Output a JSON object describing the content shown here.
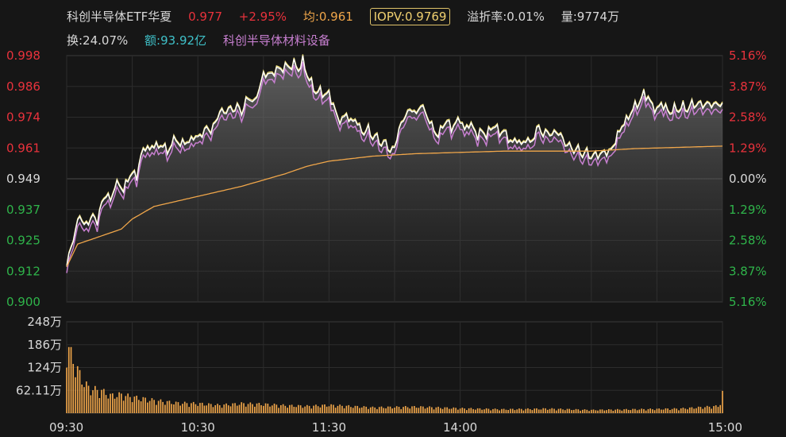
{
  "header": {
    "name": "科创半导体ETF华夏",
    "price": "0.977",
    "change_pct": "+2.95%",
    "avg": "均:0.961",
    "iopv": "IOPV:0.9769",
    "premium": "溢折率:0.01%",
    "volume": "量:9774万",
    "turnover": "换:24.07%",
    "amount": "额:93.92亿",
    "index_name": "科创半导体材料设备"
  },
  "colors": {
    "background": "#161616",
    "up": "#e8323c",
    "down": "#2fb44a",
    "neutral": "#d8d8d8",
    "price_line": "#ffffff",
    "iopv_line": "#f2e27a",
    "index_line": "#c77fd0",
    "avg_line": "#f0a64a",
    "volume_bar": "#f0a64a",
    "amount_text": "#3fc0c8"
  },
  "chart_data": {
    "type": "line",
    "x_ticks": [
      "09:30",
      "10:30",
      "11:30",
      "14:00",
      "15:00"
    ],
    "ylim": [
      0.9,
      0.998
    ],
    "y_ticks_left": [
      "0.998",
      "0.986",
      "0.974",
      "0.961",
      "0.949",
      "0.937",
      "0.925",
      "0.912",
      "0.900"
    ],
    "y_ticks_right": [
      "5.16%",
      "3.87%",
      "2.58%",
      "1.29%",
      "0.00%",
      "1.29%",
      "2.58%",
      "3.87%",
      "5.16%"
    ],
    "volume_ticks": [
      "248万",
      "186万",
      "124万",
      "62.11万"
    ],
    "volume_ylim": [
      0,
      248
    ],
    "price_anchors": [
      [
        0,
        0.914
      ],
      [
        2,
        0.922
      ],
      [
        4,
        0.928
      ],
      [
        6,
        0.935
      ],
      [
        8,
        0.93
      ],
      [
        10,
        0.932
      ],
      [
        12,
        0.934
      ],
      [
        14,
        0.932
      ],
      [
        16,
        0.939
      ],
      [
        18,
        0.943
      ],
      [
        20,
        0.94
      ],
      [
        22,
        0.946
      ],
      [
        24,
        0.947
      ],
      [
        26,
        0.944
      ],
      [
        28,
        0.949
      ],
      [
        30,
        0.951
      ],
      [
        32,
        0.95
      ],
      [
        34,
        0.958
      ],
      [
        36,
        0.962
      ],
      [
        38,
        0.96
      ],
      [
        40,
        0.963
      ],
      [
        42,
        0.961
      ],
      [
        44,
        0.963
      ],
      [
        46,
        0.959
      ],
      [
        48,
        0.963
      ],
      [
        50,
        0.965
      ],
      [
        52,
        0.962
      ],
      [
        54,
        0.964
      ],
      [
        56,
        0.963
      ],
      [
        58,
        0.966
      ],
      [
        60,
        0.965
      ],
      [
        62,
        0.967
      ],
      [
        64,
        0.969
      ],
      [
        66,
        0.968
      ],
      [
        68,
        0.971
      ],
      [
        70,
        0.976
      ],
      [
        72,
        0.975
      ],
      [
        74,
        0.977
      ],
      [
        76,
        0.976
      ],
      [
        78,
        0.978
      ],
      [
        80,
        0.975
      ],
      [
        82,
        0.98
      ],
      [
        84,
        0.981
      ],
      [
        86,
        0.979
      ],
      [
        88,
        0.985
      ],
      [
        90,
        0.99
      ],
      [
        92,
        0.991
      ],
      [
        94,
        0.99
      ],
      [
        96,
        0.993
      ],
      [
        98,
        0.992
      ],
      [
        100,
        0.994
      ],
      [
        102,
        0.993
      ],
      [
        104,
        0.995
      ],
      [
        106,
        0.992
      ],
      [
        108,
        0.996
      ],
      [
        110,
        0.99
      ],
      [
        112,
        0.987
      ],
      [
        114,
        0.983
      ],
      [
        116,
        0.984
      ],
      [
        118,
        0.982
      ],
      [
        120,
        0.983
      ],
      [
        122,
        0.978
      ],
      [
        124,
        0.973
      ],
      [
        126,
        0.972
      ],
      [
        128,
        0.975
      ],
      [
        130,
        0.971
      ],
      [
        132,
        0.973
      ],
      [
        134,
        0.969
      ],
      [
        136,
        0.967
      ],
      [
        138,
        0.969
      ],
      [
        140,
        0.965
      ],
      [
        142,
        0.966
      ],
      [
        144,
        0.962
      ],
      [
        146,
        0.964
      ],
      [
        148,
        0.959
      ],
      [
        150,
        0.962
      ],
      [
        152,
        0.968
      ],
      [
        154,
        0.973
      ],
      [
        156,
        0.975
      ],
      [
        158,
        0.977
      ],
      [
        160,
        0.974
      ],
      [
        162,
        0.979
      ],
      [
        164,
        0.975
      ],
      [
        166,
        0.972
      ],
      [
        168,
        0.968
      ],
      [
        170,
        0.966
      ],
      [
        172,
        0.97
      ],
      [
        174,
        0.972
      ],
      [
        176,
        0.969
      ],
      [
        178,
        0.971
      ],
      [
        180,
        0.973
      ],
      [
        182,
        0.968
      ],
      [
        184,
        0.971
      ],
      [
        186,
        0.969
      ],
      [
        188,
        0.966
      ],
      [
        190,
        0.968
      ],
      [
        192,
        0.966
      ],
      [
        194,
        0.969
      ],
      [
        196,
        0.97
      ],
      [
        198,
        0.967
      ],
      [
        200,
        0.968
      ],
      [
        202,
        0.965
      ],
      [
        204,
        0.963
      ],
      [
        206,
        0.965
      ],
      [
        208,
        0.962
      ],
      [
        210,
        0.965
      ],
      [
        212,
        0.963
      ],
      [
        214,
        0.966
      ],
      [
        216,
        0.97
      ],
      [
        218,
        0.966
      ],
      [
        220,
        0.968
      ],
      [
        222,
        0.966
      ],
      [
        224,
        0.968
      ],
      [
        226,
        0.966
      ],
      [
        228,
        0.963
      ],
      [
        230,
        0.962
      ],
      [
        232,
        0.96
      ],
      [
        234,
        0.961
      ],
      [
        236,
        0.958
      ],
      [
        238,
        0.96
      ],
      [
        240,
        0.957
      ],
      [
        242,
        0.959
      ],
      [
        244,
        0.958
      ],
      [
        246,
        0.96
      ],
      [
        248,
        0.959
      ],
      [
        250,
        0.962
      ],
      [
        252,
        0.966
      ],
      [
        254,
        0.97
      ],
      [
        256,
        0.972
      ],
      [
        258,
        0.975
      ],
      [
        260,
        0.978
      ],
      [
        262,
        0.979
      ],
      [
        264,
        0.983
      ],
      [
        266,
        0.981
      ],
      [
        268,
        0.978
      ],
      [
        270,
        0.976
      ],
      [
        272,
        0.979
      ],
      [
        274,
        0.977
      ],
      [
        276,
        0.975
      ],
      [
        278,
        0.977
      ],
      [
        280,
        0.976
      ],
      [
        282,
        0.978
      ],
      [
        284,
        0.976
      ],
      [
        286,
        0.979
      ],
      [
        288,
        0.978
      ],
      [
        290,
        0.979
      ],
      [
        292,
        0.978
      ],
      [
        294,
        0.979
      ],
      [
        296,
        0.978
      ],
      [
        298,
        0.979
      ],
      [
        300,
        0.978
      ]
    ],
    "iopv_offset": 0.0005,
    "index_offset": -0.0025,
    "avg_anchors": [
      [
        0,
        0.914
      ],
      [
        5,
        0.923
      ],
      [
        15,
        0.926
      ],
      [
        25,
        0.929
      ],
      [
        30,
        0.933
      ],
      [
        40,
        0.938
      ],
      [
        60,
        0.942
      ],
      [
        80,
        0.946
      ],
      [
        100,
        0.951
      ],
      [
        110,
        0.954
      ],
      [
        120,
        0.956
      ],
      [
        140,
        0.958
      ],
      [
        160,
        0.959
      ],
      [
        200,
        0.96
      ],
      [
        240,
        0.96
      ],
      [
        260,
        0.961
      ],
      [
        280,
        0.9615
      ],
      [
        300,
        0.962
      ]
    ],
    "volume_anchors": [
      [
        0,
        225
      ],
      [
        2,
        180
      ],
      [
        4,
        150
      ],
      [
        6,
        120
      ],
      [
        8,
        95
      ],
      [
        10,
        80
      ],
      [
        12,
        75
      ],
      [
        16,
        70
      ],
      [
        20,
        55
      ],
      [
        25,
        58
      ],
      [
        30,
        50
      ],
      [
        35,
        45
      ],
      [
        40,
        40
      ],
      [
        50,
        32
      ],
      [
        60,
        30
      ],
      [
        70,
        25
      ],
      [
        80,
        30
      ],
      [
        90,
        28
      ],
      [
        100,
        24
      ],
      [
        110,
        22
      ],
      [
        120,
        25
      ],
      [
        140,
        18
      ],
      [
        160,
        20
      ],
      [
        180,
        15
      ],
      [
        200,
        12
      ],
      [
        220,
        14
      ],
      [
        240,
        10
      ],
      [
        260,
        12
      ],
      [
        280,
        14
      ],
      [
        298,
        22
      ],
      [
        299,
        32
      ],
      [
        300,
        63
      ]
    ]
  }
}
